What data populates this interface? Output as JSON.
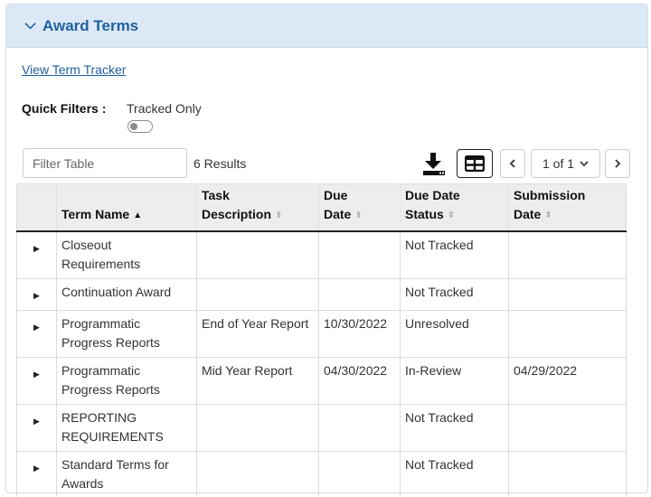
{
  "panel": {
    "title": "Award Terms"
  },
  "links": {
    "term_tracker": "View Term Tracker"
  },
  "quick_filters": {
    "label": "Quick Filters :",
    "tracked_only": "Tracked Only",
    "tracked_only_on": false
  },
  "toolbar": {
    "filter_placeholder": "Filter Table",
    "results": "6 Results",
    "page": "1 of 1"
  },
  "table": {
    "headers": {
      "term_name": "Term Name",
      "task_description_1": "Task",
      "task_description_2": "Description",
      "due_date_1": "Due",
      "due_date_2": "Date",
      "status_1": "Due Date",
      "status_2": "Status",
      "submission_1": "Submission",
      "submission_2": "Date"
    },
    "rows": [
      {
        "term_name": "Closeout Requirements",
        "task": "",
        "due": "",
        "status": "Not Tracked",
        "submission": ""
      },
      {
        "term_name": "Continuation Award",
        "task": "",
        "due": "",
        "status": "Not Tracked",
        "submission": ""
      },
      {
        "term_name": "Programmatic Progress Reports",
        "task": "End of Year Report",
        "due": "10/30/2022",
        "status": "Unresolved",
        "submission": ""
      },
      {
        "term_name": "Programmatic Progress Reports",
        "task": "Mid Year Report",
        "due": "04/30/2022",
        "status": "In-Review",
        "submission": "04/29/2022"
      },
      {
        "term_name": "REPORTING REQUIREMENTS",
        "task": "",
        "due": "",
        "status": "Not Tracked",
        "submission": ""
      },
      {
        "term_name": "Standard Terms for Awards",
        "task": "",
        "due": "",
        "status": "Not Tracked",
        "submission": ""
      }
    ]
  },
  "colors": {
    "accent": "#1f5f9e",
    "header_bg": "#dce8f6",
    "table_header_bg": "#ecedef"
  },
  "icons": {
    "collapse": "chevron-down-icon",
    "download": "download-icon",
    "columns": "table-columns-icon",
    "prev": "chevron-left-icon",
    "next": "chevron-right-icon",
    "expand": "caret-right-icon"
  }
}
